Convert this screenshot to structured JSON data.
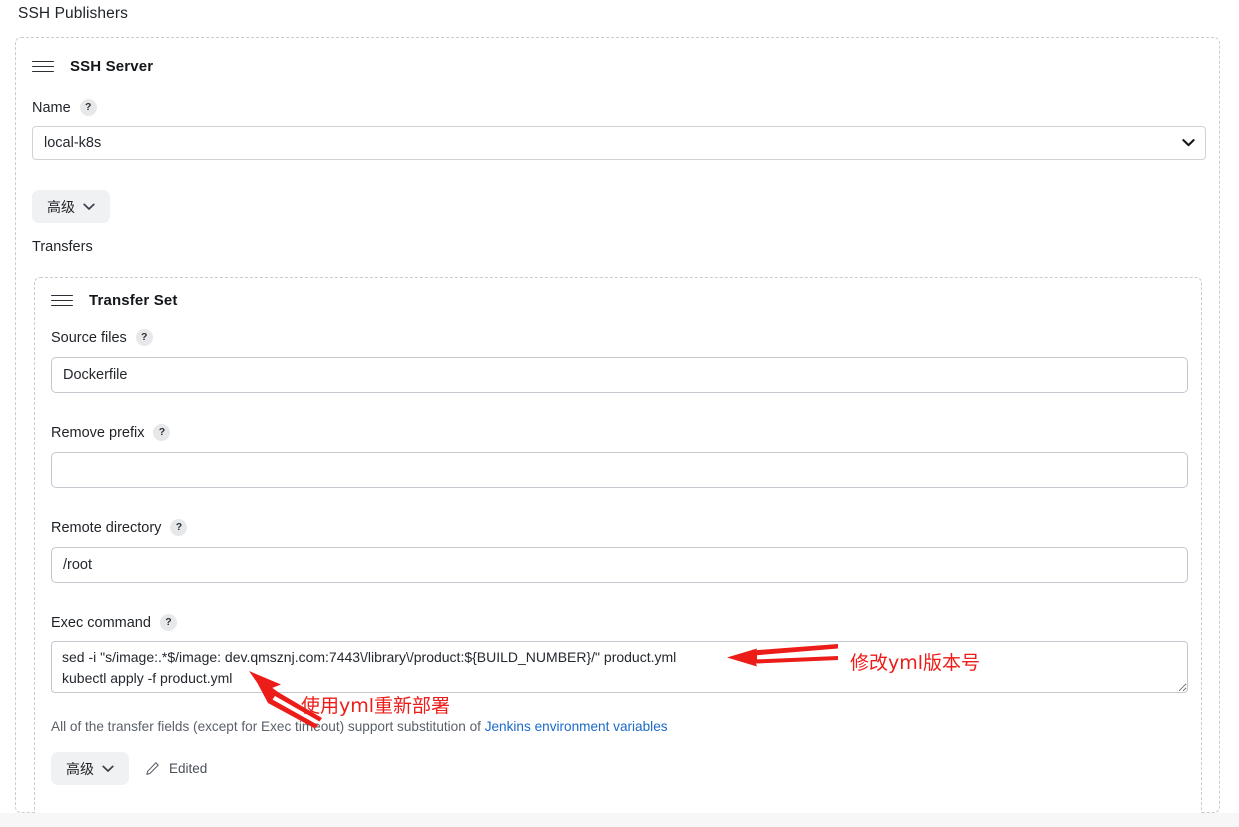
{
  "page": {
    "heading": "SSH Publishers"
  },
  "ssh_server": {
    "title": "SSH Server",
    "drag_handle_icon": "hamburger-drag-icon",
    "name_label": "Name",
    "help_glyph": "?",
    "name_value": "local-k8s",
    "name_options": [
      "local-k8s"
    ],
    "chevron_icon": "chevron-down-icon",
    "advanced_label": "高级",
    "transfers_label": "Transfers"
  },
  "transfer_set": {
    "title": "Transfer Set",
    "drag_handle_icon": "hamburger-drag-icon",
    "source_files_label": "Source files",
    "source_files_value": "Dockerfile",
    "remove_prefix_label": "Remove prefix",
    "remove_prefix_value": "",
    "remote_directory_label": "Remote directory",
    "remote_directory_value": "/root",
    "exec_command_label": "Exec command",
    "exec_command_value": "sed -i \"s/image:.*$/image: dev.qmsznj.com:7443\\/library\\/product:${BUILD_NUMBER}/\" product.yml\nkubectl apply -f product.yml",
    "note_prefix": "All of the transfer fields (except for Exec timeout) support substitution of ",
    "note_link": "Jenkins environment variables",
    "advanced_label": "高级",
    "edited_label": "Edited",
    "edited_icon": "pencil-icon"
  },
  "annotations": {
    "color": "#ec1c18",
    "items": [
      {
        "text": "修改yml版本号",
        "arrow": "arrow-left"
      },
      {
        "text": "使用yml重新部署",
        "arrow": "arrow-up-left"
      }
    ]
  }
}
